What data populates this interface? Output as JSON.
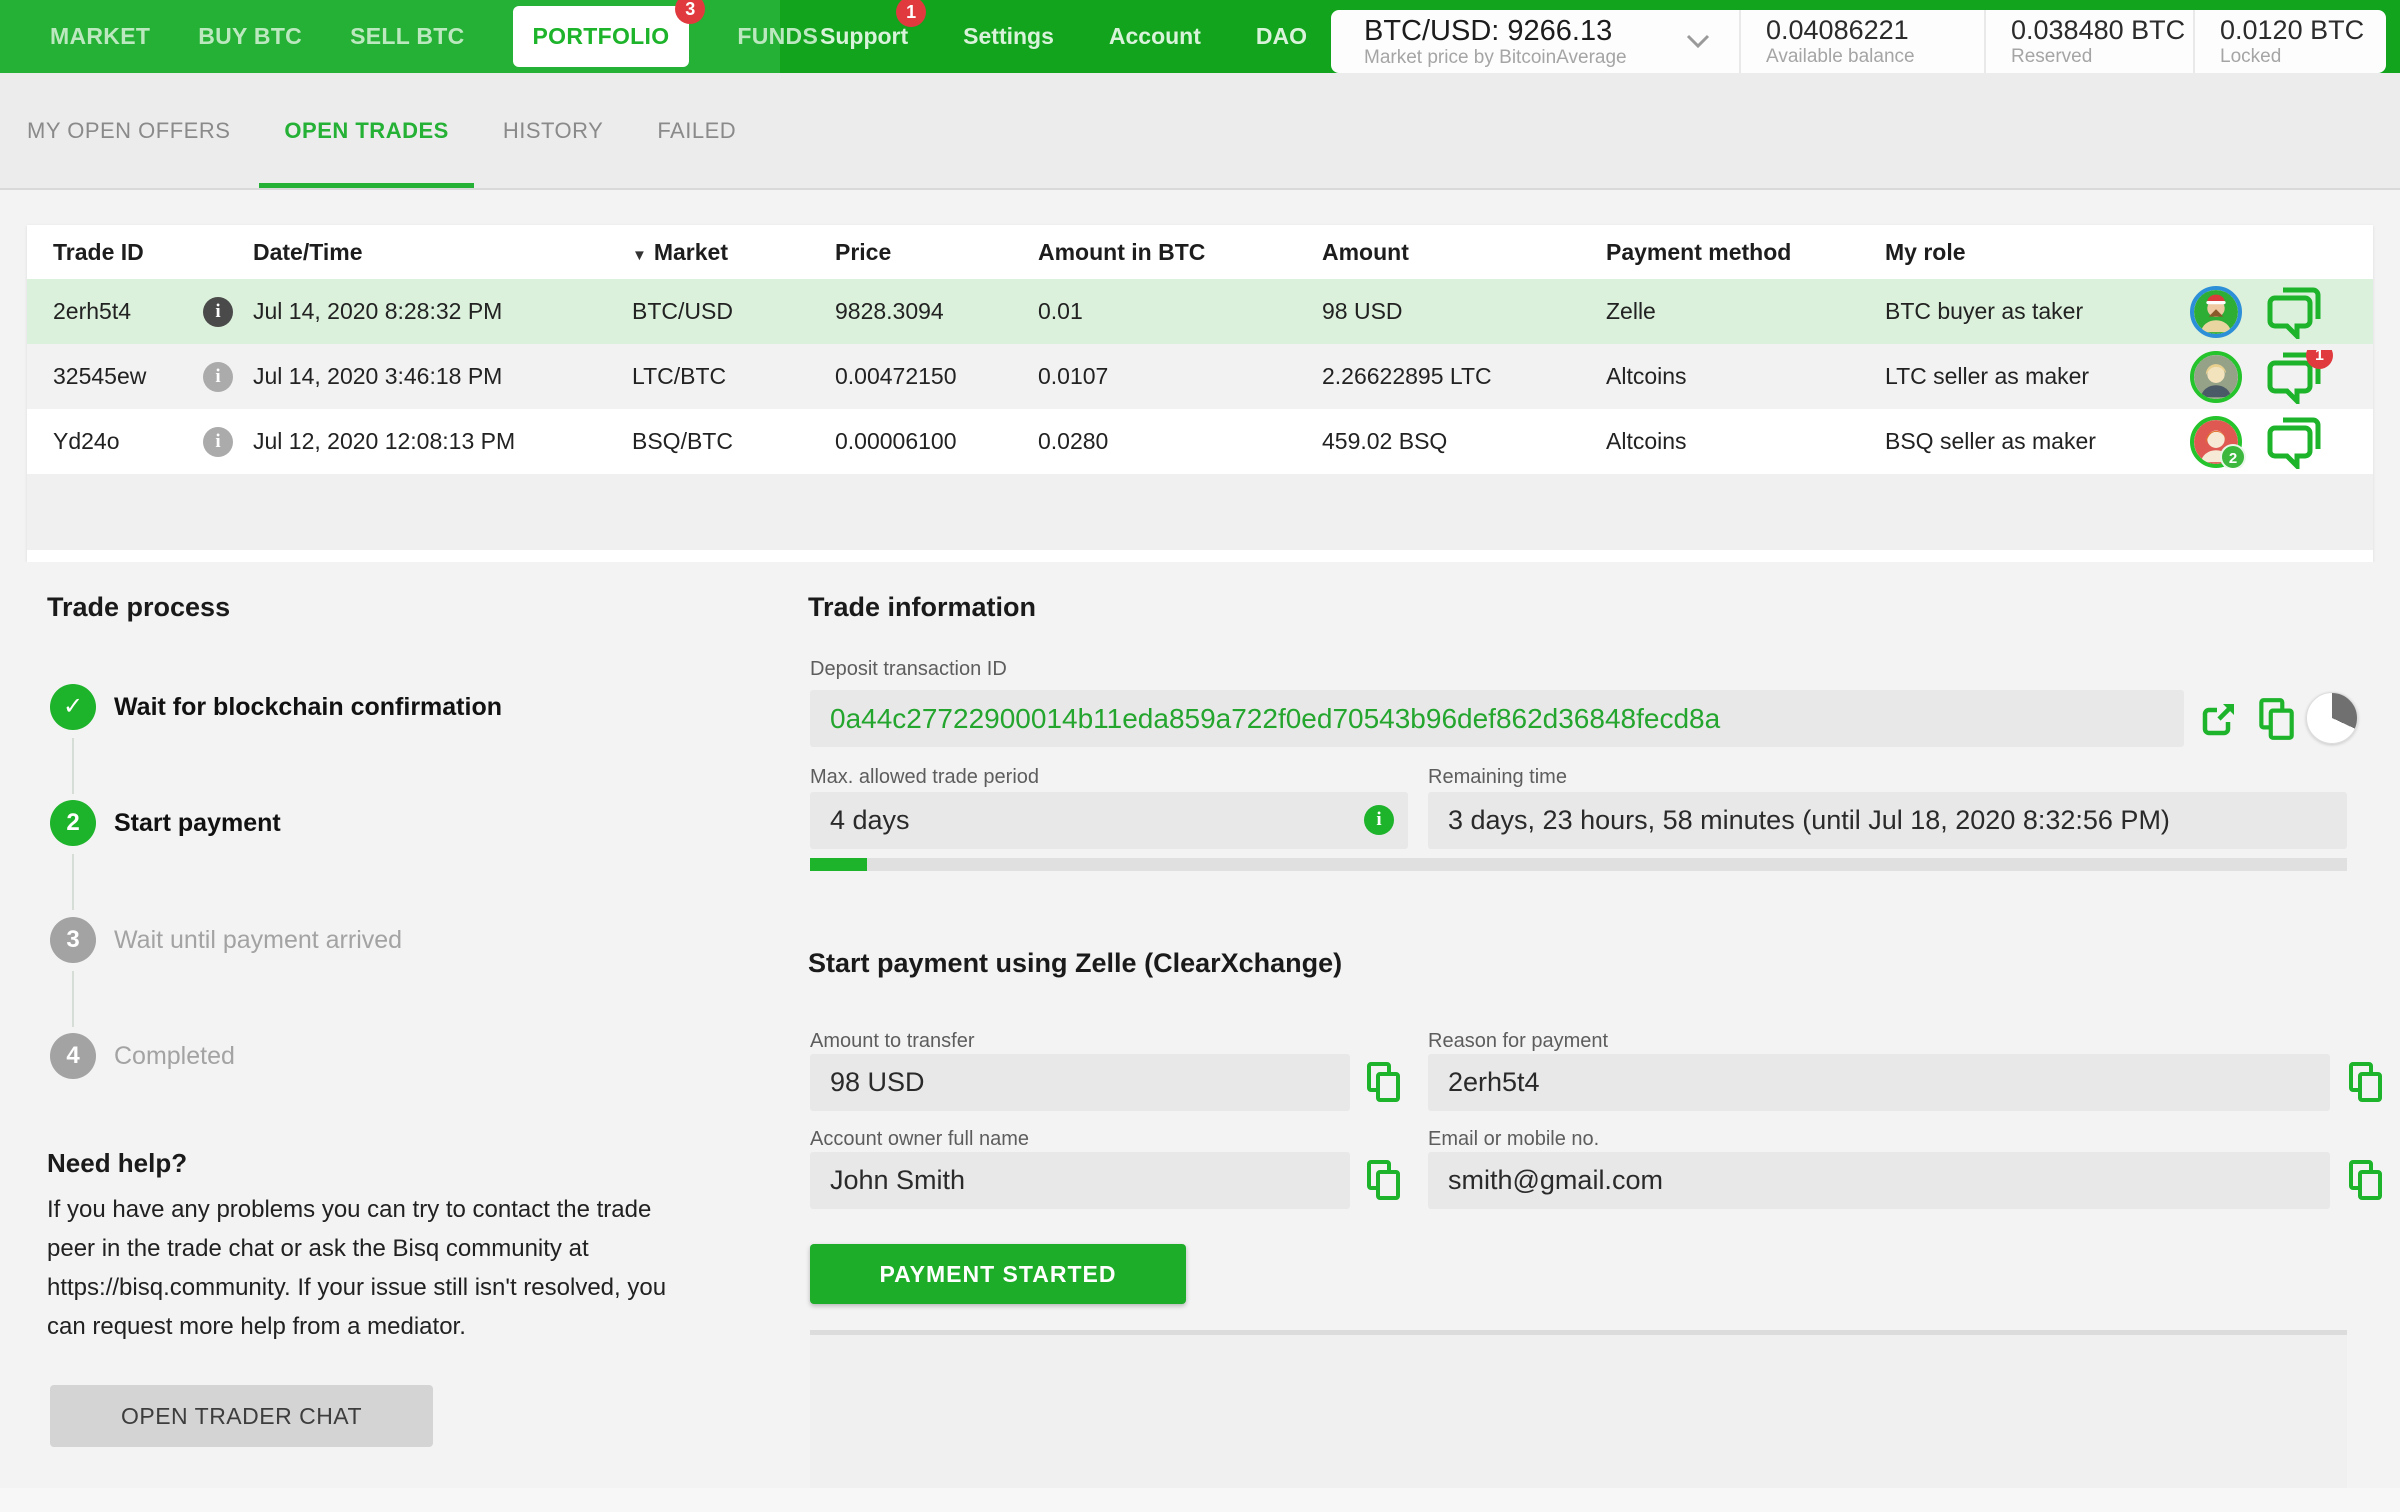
{
  "icons": {
    "info": "i",
    "check": "✓",
    "sort_desc": "▼"
  },
  "nav": {
    "left_items": [
      {
        "label": "MARKET"
      },
      {
        "label": "BUY BTC"
      },
      {
        "label": "SELL BTC"
      },
      {
        "label": "PORTFOLIO",
        "badge": "3",
        "active": true
      },
      {
        "label": "FUNDS"
      }
    ],
    "right_items": [
      {
        "label": "Support",
        "badge": "1"
      },
      {
        "label": "Settings"
      },
      {
        "label": "Account"
      },
      {
        "label": "DAO"
      }
    ],
    "ticker": {
      "pair_price": "BTC/USD: 9266.13",
      "subtitle": "Market price by BitcoinAverage"
    },
    "balances": [
      {
        "value": "0.04086221",
        "label": "Available balance"
      },
      {
        "value": "0.038480 BTC",
        "label": "Reserved"
      },
      {
        "value": "0.0120 BTC",
        "label": "Locked"
      }
    ]
  },
  "tabs": [
    {
      "label": "MY OPEN OFFERS"
    },
    {
      "label": "OPEN TRADES"
    },
    {
      "label": "HISTORY"
    },
    {
      "label": "FAILED"
    }
  ],
  "table": {
    "columns": [
      "Trade ID",
      "Date/Time",
      "Market",
      "Price",
      "Amount in BTC",
      "Amount",
      "Payment method",
      "My role"
    ],
    "rows": [
      {
        "trade_id": "2erh5t4",
        "datetime": "Jul 14, 2020 8:28:32 PM",
        "market": "BTC/USD",
        "price": "9828.3094",
        "amount_btc": "0.01",
        "amount": "98 USD",
        "payment_method": "Zelle",
        "my_role": "BTC buyer as taker",
        "chat_badge": "",
        "avatar_badge": ""
      },
      {
        "trade_id": "32545ew",
        "datetime": "Jul 14, 2020 3:46:18 PM",
        "market": "LTC/BTC",
        "price": "0.00472150",
        "amount_btc": "0.0107",
        "amount": "2.26622895 LTC",
        "payment_method": "Altcoins",
        "my_role": "LTC seller as maker",
        "chat_badge": "1",
        "avatar_badge": ""
      },
      {
        "trade_id": "Yd24o",
        "datetime": "Jul 12, 2020 12:08:13 PM",
        "market": "BSQ/BTC",
        "price": "0.00006100",
        "amount_btc": "0.0280",
        "amount": "459.02 BSQ",
        "payment_method": "Altcoins",
        "my_role": "BSQ seller as maker",
        "chat_badge": "",
        "avatar_badge": "2"
      }
    ]
  },
  "trade_process": {
    "title": "Trade process",
    "steps": [
      {
        "label": "Wait for blockchain confirmation",
        "state": "done"
      },
      {
        "number": "2",
        "label": "Start payment",
        "state": "active"
      },
      {
        "number": "3",
        "label": "Wait until payment arrived",
        "state": "future"
      },
      {
        "number": "4",
        "label": "Completed",
        "state": "future"
      }
    ],
    "help": {
      "title": "Need help?",
      "body": "If you have any problems you can try to contact the trade peer in the trade chat or ask the Bisq community at https://bisq.community. If your issue still isn't resolved, you can request more help from a mediator.",
      "button": "OPEN TRADER CHAT"
    }
  },
  "trade_info": {
    "title": "Trade information",
    "deposit_tx": {
      "label": "Deposit transaction ID",
      "value": "0a44c27722900014b11eda859a722f0ed70543b96def862d36848fecd8a"
    },
    "trade_period": {
      "label": "Max. allowed trade period",
      "value": "4 days"
    },
    "remaining_time": {
      "label": "Remaining time",
      "value": "3 days, 23 hours, 58 minutes (until Jul 18, 2020 8:32:56 PM)"
    },
    "progress_percent": 3.7,
    "payment": {
      "title": "Start payment using Zelle (ClearXchange)",
      "amount": {
        "label": "Amount to transfer",
        "value": "98 USD"
      },
      "reason": {
        "label": "Reason for payment",
        "value": "2erh5t4"
      },
      "owner": {
        "label": "Account owner full name",
        "value": "John Smith"
      },
      "email": {
        "label": "Email or mobile no.",
        "value": "smith@gmail.com"
      },
      "button": "PAYMENT STARTED"
    }
  },
  "colors": {
    "nav_green": "#25b135",
    "nav_green_dark": "#12a41d",
    "accent_green": "#1db32a",
    "badge_red": "#e03a3f",
    "selected_row_green": "#dcf1dc",
    "tx_green_text": "#24a52e"
  }
}
